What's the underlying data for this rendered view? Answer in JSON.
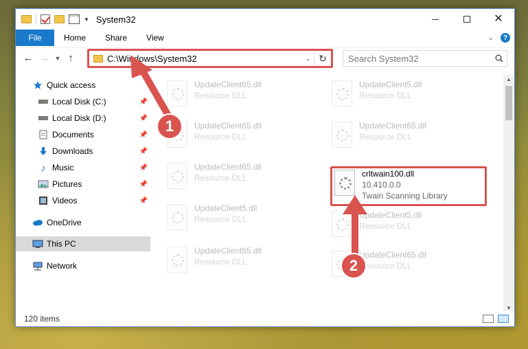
{
  "window": {
    "title": "System32",
    "controls": {
      "minimize": "—",
      "maximize": "☐",
      "close": "✕"
    }
  },
  "ribbon": {
    "tabs": [
      "File",
      "Home",
      "Share",
      "View"
    ]
  },
  "nav": {
    "back": "←",
    "forward": "→",
    "recent": "⌄",
    "up": "↑",
    "address": "C:\\Windows\\System32",
    "search_placeholder": "Search System32"
  },
  "sidebar": {
    "items": [
      {
        "label": "Quick access",
        "icon": "star-icon",
        "pinned": false
      },
      {
        "label": "Local Disk (C:)",
        "icon": "drive-icon",
        "pinned": true
      },
      {
        "label": "Local Disk (D:)",
        "icon": "drive-icon",
        "pinned": true
      },
      {
        "label": "Documents",
        "icon": "documents-icon",
        "pinned": true
      },
      {
        "label": "Downloads",
        "icon": "downloads-icon",
        "pinned": true
      },
      {
        "label": "Music",
        "icon": "music-icon",
        "pinned": true
      },
      {
        "label": "Pictures",
        "icon": "pictures-icon",
        "pinned": true
      },
      {
        "label": "Videos",
        "icon": "videos-icon",
        "pinned": true
      },
      {
        "label": "OneDrive",
        "icon": "cloud-icon",
        "pinned": false
      },
      {
        "label": "This PC",
        "icon": "computer-icon",
        "pinned": false,
        "selected": true
      },
      {
        "label": "Network",
        "icon": "network-icon",
        "pinned": false
      }
    ]
  },
  "files": [
    {
      "name": "UpdateClient65.dll",
      "desc": "Resource DLL",
      "faded": true
    },
    {
      "name": "UpdateClient5.dll",
      "desc": "Resource DLL",
      "faded": true
    },
    {
      "name": "UpdateClient65.dll",
      "desc": "Resource DLL",
      "faded": true
    },
    {
      "name": "UpdateClient65.dll",
      "desc": "Resource DLL",
      "faded": true
    },
    {
      "name": "UpdateClient65.dll",
      "desc": "Resource DLL",
      "faded": true
    },
    {
      "name": "crltwain100.dll",
      "desc": "10.410.0.0",
      "desc2": "Twain Scanning Library",
      "faded": false
    },
    {
      "name": "UpdateClient5.dll",
      "desc": "Resource DLL",
      "faded": true
    },
    {
      "name": "UpdateClient5.dll",
      "desc": "Resource DLL",
      "faded": true
    },
    {
      "name": "UpdateClient65.dll",
      "desc": "Resource DLL",
      "faded": true
    },
    {
      "name": "UpdateClient65.dll",
      "desc": "Resource DLL",
      "faded": true
    }
  ],
  "status": {
    "items": "120 items"
  },
  "annotations": {
    "step1": "1",
    "step2": "2"
  },
  "colors": {
    "accent": "#1979ca",
    "annotation": "#d9534f"
  }
}
